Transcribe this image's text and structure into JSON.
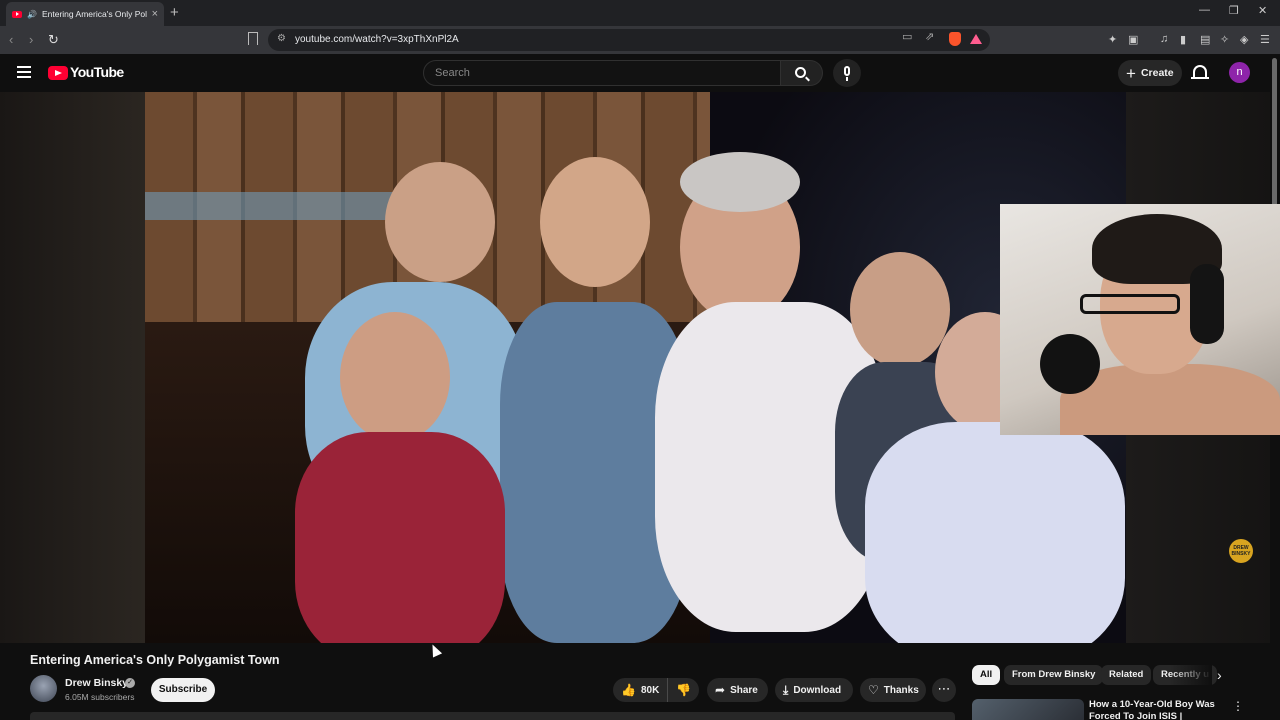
{
  "browser": {
    "tab_title": "Entering America's Only Polyg",
    "new_tab_label": "+",
    "url": "youtube.com/watch?v=3xpThXnPl2A"
  },
  "header": {
    "logo_text": "YouTube",
    "search_placeholder": "Search",
    "create_label": "Create",
    "avatar_letter": "n"
  },
  "video": {
    "title": "Entering America's Only Polygamist Town",
    "watermark_text": "DREW BINSKY"
  },
  "channel": {
    "name": "Drew Binsky",
    "subscribers": "6.05M subscribers",
    "subscribe_label": "Subscribe"
  },
  "actions": {
    "likes": "80K",
    "share_label": "Share",
    "download_label": "Download",
    "thanks_label": "Thanks"
  },
  "chips": [
    "All",
    "From Drew Binsky",
    "Related",
    "Recently u"
  ],
  "recommendation": {
    "title": "How a 10-Year-Old Boy Was Forced To Join ISIS |"
  },
  "icons": {
    "tab_favicon": "youtube-icon",
    "audio": "speaker-icon",
    "bookmark": "bookmark-icon",
    "search": "search-icon",
    "mic": "mic-icon",
    "notifications": "bell-icon",
    "like": "thumbs-up-icon",
    "dislike": "thumbs-down-icon",
    "share": "share-icon",
    "download": "download-icon",
    "thanks": "thanks-icon"
  },
  "colors": {
    "accent_red": "#ff0033",
    "avatar_bg": "#8e24aa",
    "page_bg": "#0f0f0f"
  }
}
